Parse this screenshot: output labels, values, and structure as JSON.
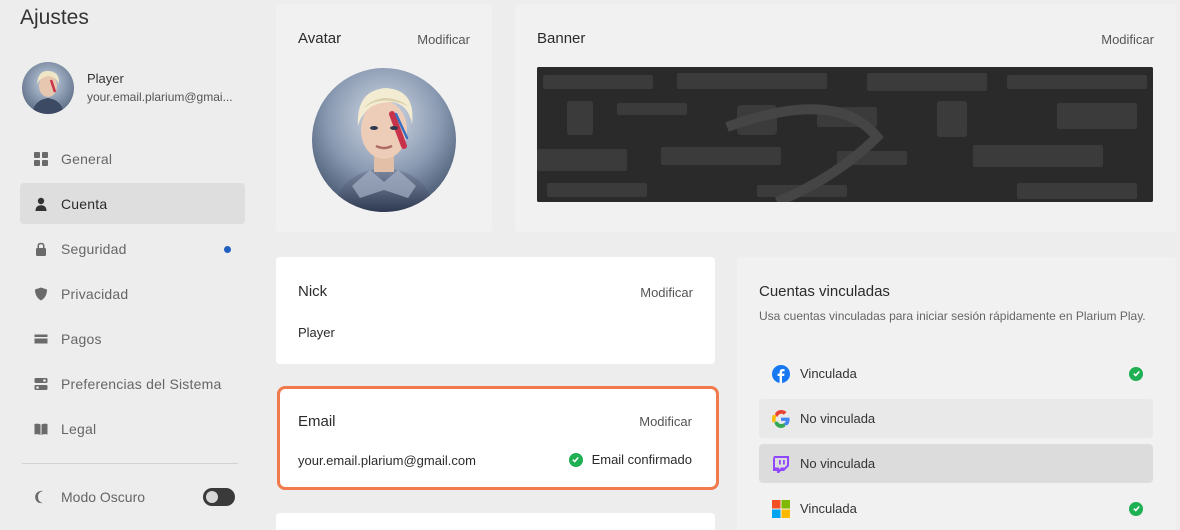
{
  "sidebar": {
    "title": "Ajustes",
    "profile": {
      "name": "Player",
      "email": "your.email.plarium@gmai..."
    },
    "items": [
      {
        "label": "General",
        "icon": "grid-icon"
      },
      {
        "label": "Cuenta",
        "icon": "user-icon",
        "active": true
      },
      {
        "label": "Seguridad",
        "icon": "lock-icon",
        "badge": true
      },
      {
        "label": "Privacidad",
        "icon": "shield-icon"
      },
      {
        "label": "Pagos",
        "icon": "card-icon"
      },
      {
        "label": "Preferencias del Sistema",
        "icon": "settings-toggle-icon"
      },
      {
        "label": "Legal",
        "icon": "book-icon"
      }
    ],
    "dark_mode": {
      "label": "Modo Oscuro",
      "enabled": true
    }
  },
  "avatar": {
    "title": "Avatar",
    "action": "Modificar"
  },
  "banner": {
    "title": "Banner",
    "action": "Modificar"
  },
  "nick": {
    "title": "Nick",
    "action": "Modificar",
    "value": "Player"
  },
  "email": {
    "title": "Email",
    "action": "Modificar",
    "value": "your.email.plarium@gmail.com",
    "status": "Email confirmado"
  },
  "linked": {
    "title": "Cuentas vinculadas",
    "description": "Usa cuentas vinculadas para iniciar sesión rápidamente en Plarium Play.",
    "accounts": [
      {
        "provider_icon": "facebook-icon",
        "status": "Vinculada",
        "linked": true
      },
      {
        "provider_icon": "google-icon",
        "status": "No vinculada",
        "linked": false
      },
      {
        "provider_icon": "twitch-icon",
        "status": "No vinculada",
        "linked": false
      },
      {
        "provider_icon": "microsoft-icon",
        "status": "Vinculada",
        "linked": true
      }
    ]
  },
  "colors": {
    "accent_highlight": "#f07a4c",
    "success": "#1fb054",
    "badge": "#1f5fbf"
  }
}
